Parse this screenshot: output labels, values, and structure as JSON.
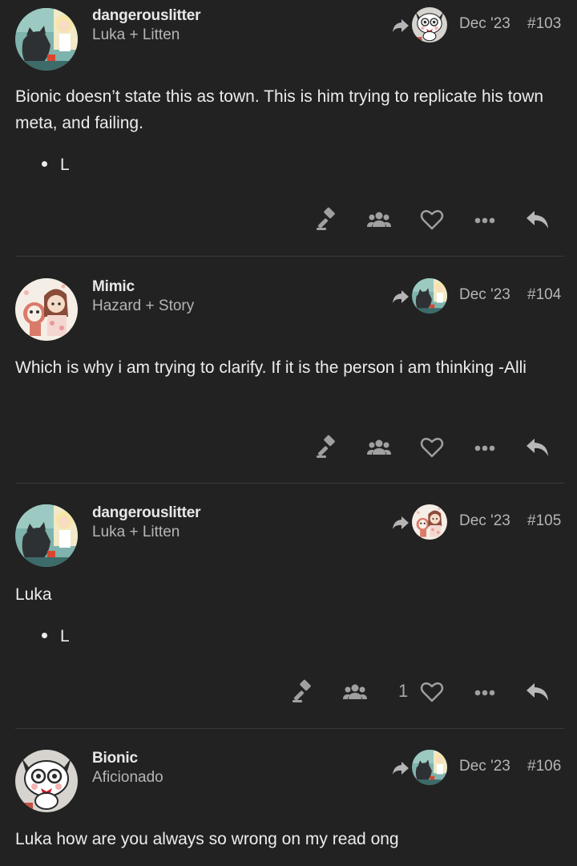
{
  "posts": [
    {
      "username": "dangerouslitter",
      "title": "Luka + Litten",
      "date": "Dec '23",
      "number": "#103",
      "body": "Bionic doesn’t state this as town. This is him trying to replicate his town meta, and failing.",
      "bullet": "L",
      "likes": ""
    },
    {
      "username": "Mimic",
      "title": "Hazard + Story",
      "date": "Dec '23",
      "number": "#104",
      "body": "Which is why i am trying to clarify. If it is the person i am thinking -Alli",
      "likes": ""
    },
    {
      "username": "dangerouslitter",
      "title": "Luka + Litten",
      "date": "Dec '23",
      "number": "#105",
      "body": "Luka",
      "bullet": "L",
      "likes": "1"
    },
    {
      "username": "Bionic",
      "title": "Aficionado",
      "date": "Dec '23",
      "number": "#106",
      "body": "Luka how are you always so wrong on my read ong"
    }
  ],
  "icons": {
    "action_color": "#a0a0a0",
    "gavel": "gavel-icon",
    "group": "users-icon",
    "like": "heart-icon",
    "more": "ellipsis-icon",
    "reply": "reply-icon",
    "reply_to": "share-arrow-icon"
  }
}
